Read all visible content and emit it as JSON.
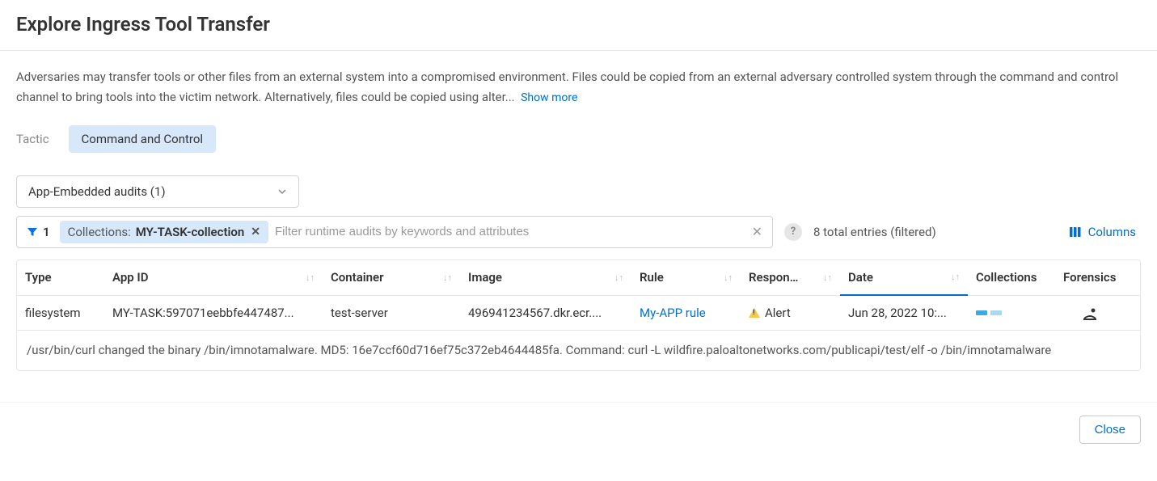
{
  "header": {
    "title": "Explore Ingress Tool Transfer"
  },
  "description": {
    "text": "Adversaries may transfer tools or other files from an external system into a compromised environment. Files could be copied from an external adversary controlled system through the command and control channel to bring tools into the victim network. Alternatively, files could be copied using alter...",
    "show_more": "Show more"
  },
  "tactic": {
    "label": "Tactic",
    "value": "Command and Control"
  },
  "dropdown": {
    "selected": "App-Embedded audits (1)"
  },
  "filter": {
    "active_count": "1",
    "chip_label": "Collections: ",
    "chip_value": "MY-TASK-collection",
    "placeholder": "Filter runtime audits by keywords and attributes"
  },
  "entries_text": "8 total entries (filtered)",
  "columns_button": "Columns",
  "table": {
    "headers": {
      "type": "Type",
      "appid": "App ID",
      "container": "Container",
      "image": "Image",
      "rule": "Rule",
      "response": "Respon…",
      "date": "Date",
      "collections": "Collections",
      "forensics": "Forensics"
    },
    "rows": [
      {
        "type": "filesystem",
        "appid": "MY-TASK:597071eebbfe447487...",
        "container": "test-server",
        "image": "496941234567.dkr.ecr....",
        "rule": "My-APP rule",
        "response": "Alert",
        "date": "Jun 28, 2022 10:...",
        "detail": "/usr/bin/curl changed the binary /bin/imnotamalware. MD5: 16e7ccf60d716ef75c372eb4644485fa. Command: curl -L wildfire.paloaltonetworks.com/publicapi/test/elf -o /bin/imnotamalware"
      }
    ]
  },
  "footer": {
    "close": "Close"
  }
}
